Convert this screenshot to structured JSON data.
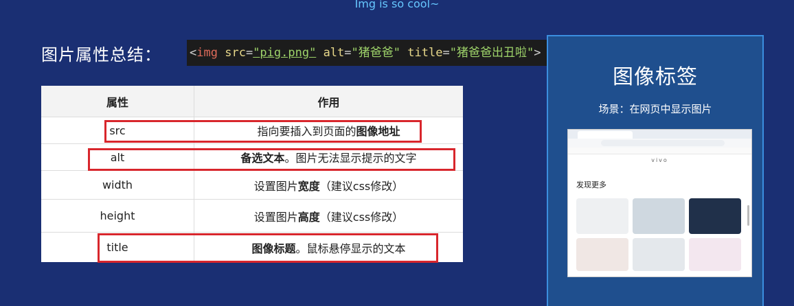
{
  "top_caption": "Img is so cool~",
  "heading": "图片属性总结：",
  "code": {
    "open": "<",
    "tag": "img",
    "attr1": "src",
    "eq1": "=",
    "val1": "\"pig.png\"",
    "attr2": "alt",
    "eq2": "=",
    "val2": "\"猪爸爸\"",
    "attr3": "title",
    "eq3": "=",
    "val3": "\"猪爸爸出丑啦\"",
    "close": ">"
  },
  "table": {
    "headers": [
      "属性",
      "作用"
    ],
    "rows": [
      {
        "attr": "src",
        "desc_plain": "指向要插入到页面的",
        "desc_bold": "图像地址",
        "desc_tail": ""
      },
      {
        "attr": "alt",
        "desc_plain": "",
        "desc_bold": "备选文本",
        "desc_tail": "。图片无法显示提示的文字"
      },
      {
        "attr": "width",
        "desc_plain": "设置图片",
        "desc_bold": "宽度",
        "desc_tail": "（建议css修改）"
      },
      {
        "attr": "height",
        "desc_plain": "设置图片",
        "desc_bold": "高度",
        "desc_tail": "（建议css修改）"
      },
      {
        "attr": "title",
        "desc_plain": "",
        "desc_bold": "图像标题",
        "desc_tail": "。鼠标悬停显示的文本"
      }
    ]
  },
  "side": {
    "title": "图像标签",
    "subtitle": "场景：在网页中显示图片",
    "screenshot": {
      "logo": "vivo",
      "section": "发现更多"
    }
  },
  "colors": {
    "background": "#1a2f73",
    "highlight_box": "#d8262c",
    "side_panel": "#1f4f8e"
  }
}
